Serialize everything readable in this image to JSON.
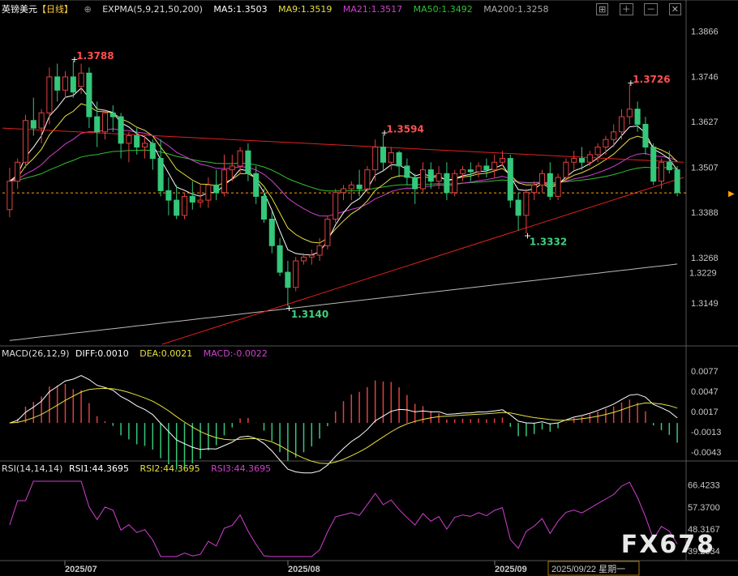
{
  "header": {
    "symbol": "英镑美元",
    "period": "【日线】",
    "expma": "EXPMA(5,9,21,50,200)",
    "ma5": "MA5:1.3503",
    "ma9": "MA9:1.3519",
    "ma21": "MA21:1.3517",
    "ma50": "MA50:1.3492",
    "ma200": "MA200:1.3258"
  },
  "macd_header": {
    "title": "MACD(26,12,9)",
    "diff": "DIFF:0.0010",
    "dea": "DEA:0.0021",
    "macd": "MACD:-0.0022"
  },
  "rsi_header": {
    "title": "RSI(14,14,14)",
    "rsi1": "RSI1:44.3695",
    "rsi2": "RSI2:44.3695",
    "rsi3": "RSI3:44.3695"
  },
  "x_labels": [
    "2025/07",
    "2025/08",
    "2025/09",
    "2025/09/22 星期一"
  ],
  "watermark": "FX678",
  "colors": {
    "up": "#e04040",
    "down": "#35c77a",
    "ma5": "#ffffff",
    "ma9": "#e8e040",
    "ma21": "#d040d0",
    "ma50": "#30c030",
    "ma200": "#bbbbbb",
    "trend": "#e02020",
    "current": "#ffa500"
  },
  "chart_data": [
    {
      "type": "candlestick",
      "title": "英镑美元【日线】",
      "y_ticks": [
        1.3866,
        1.3746,
        1.3627,
        1.3507,
        1.3388,
        1.3268,
        1.3149
      ],
      "current_price": 1.3439,
      "current_label": "1.3229",
      "ylim": [
        1.304,
        1.3905
      ],
      "annotations": [
        {
          "text": "1.3788",
          "type": "high"
        },
        {
          "text": "1.3594",
          "type": "high"
        },
        {
          "text": "1.3726",
          "type": "high"
        },
        {
          "text": "1.3140",
          "type": "low"
        },
        {
          "text": "1.3332",
          "type": "low"
        }
      ],
      "candles": [
        [
          1.3395,
          1.3505,
          1.347,
          1.3375
        ],
        [
          1.347,
          1.353,
          1.352,
          1.345
        ],
        [
          1.352,
          1.3645,
          1.363,
          1.3505
        ],
        [
          1.363,
          1.369,
          1.361,
          1.359
        ],
        [
          1.361,
          1.366,
          1.365,
          1.357
        ],
        [
          1.365,
          1.377,
          1.3745,
          1.362
        ],
        [
          1.3745,
          1.378,
          1.371,
          1.368
        ],
        [
          1.371,
          1.376,
          1.3745,
          1.369
        ],
        [
          1.3745,
          1.3788,
          1.3705,
          1.369
        ],
        [
          1.372,
          1.378,
          1.3755,
          1.37
        ],
        [
          1.3755,
          1.377,
          1.364,
          1.361
        ],
        [
          1.364,
          1.368,
          1.36,
          1.356
        ],
        [
          1.36,
          1.366,
          1.365,
          1.358
        ],
        [
          1.365,
          1.367,
          1.364,
          1.36
        ],
        [
          1.364,
          1.365,
          1.357,
          1.353
        ],
        [
          1.357,
          1.36,
          1.359,
          1.352
        ],
        [
          1.359,
          1.361,
          1.356,
          1.354
        ],
        [
          1.356,
          1.359,
          1.357,
          1.353
        ],
        [
          1.357,
          1.358,
          1.353,
          1.35
        ],
        [
          1.353,
          1.358,
          1.3445,
          1.343
        ],
        [
          1.3445,
          1.348,
          1.342,
          1.338
        ],
        [
          1.342,
          1.346,
          1.338,
          1.337
        ],
        [
          1.338,
          1.344,
          1.343,
          1.337
        ],
        [
          1.343,
          1.347,
          1.3415,
          1.3395
        ],
        [
          1.3415,
          1.346,
          1.342,
          1.34
        ],
        [
          1.342,
          1.348,
          1.346,
          1.34
        ],
        [
          1.346,
          1.35,
          1.344,
          1.342
        ],
        [
          1.344,
          1.354,
          1.35,
          1.343
        ],
        [
          1.35,
          1.354,
          1.351,
          1.347
        ],
        [
          1.351,
          1.356,
          1.355,
          1.349
        ],
        [
          1.355,
          1.357,
          1.349,
          1.347
        ],
        [
          1.349,
          1.351,
          1.343,
          1.341
        ],
        [
          1.343,
          1.345,
          1.337,
          1.336
        ],
        [
          1.337,
          1.339,
          1.33,
          1.328
        ],
        [
          1.33,
          1.332,
          1.323,
          1.322
        ],
        [
          1.323,
          1.326,
          1.319,
          1.314
        ],
        [
          1.319,
          1.327,
          1.326,
          1.318
        ],
        [
          1.326,
          1.328,
          1.327,
          1.325
        ],
        [
          1.327,
          1.329,
          1.3275,
          1.325
        ],
        [
          1.3275,
          1.332,
          1.33,
          1.326
        ],
        [
          1.33,
          1.338,
          1.337,
          1.329
        ],
        [
          1.337,
          1.345,
          1.344,
          1.336
        ],
        [
          1.344,
          1.346,
          1.345,
          1.342
        ],
        [
          1.345,
          1.347,
          1.346,
          1.342
        ],
        [
          1.346,
          1.35,
          1.345,
          1.343
        ],
        [
          1.345,
          1.351,
          1.35,
          1.344
        ],
        [
          1.35,
          1.358,
          1.356,
          1.347
        ],
        [
          1.356,
          1.3594,
          1.352,
          1.35
        ],
        [
          1.352,
          1.356,
          1.3545,
          1.35
        ],
        [
          1.3545,
          1.355,
          1.351,
          1.348
        ],
        [
          1.351,
          1.353,
          1.348,
          1.346
        ],
        [
          1.348,
          1.349,
          1.345,
          1.341
        ],
        [
          1.345,
          1.352,
          1.35,
          1.344
        ],
        [
          1.35,
          1.352,
          1.347,
          1.345
        ],
        [
          1.347,
          1.351,
          1.349,
          1.345
        ],
        [
          1.349,
          1.352,
          1.344,
          1.342
        ],
        [
          1.344,
          1.35,
          1.349,
          1.343
        ],
        [
          1.349,
          1.351,
          1.35,
          1.347
        ],
        [
          1.35,
          1.352,
          1.3495,
          1.347
        ],
        [
          1.3495,
          1.352,
          1.351,
          1.348
        ],
        [
          1.351,
          1.353,
          1.35,
          1.348
        ],
        [
          1.35,
          1.354,
          1.352,
          1.348
        ],
        [
          1.352,
          1.355,
          1.353,
          1.351
        ],
        [
          1.353,
          1.354,
          1.342,
          1.34
        ],
        [
          1.342,
          1.344,
          1.338,
          1.334
        ],
        [
          1.338,
          1.345,
          1.344,
          1.3332
        ],
        [
          1.344,
          1.347,
          1.346,
          1.342
        ],
        [
          1.346,
          1.35,
          1.349,
          1.344
        ],
        [
          1.349,
          1.352,
          1.343,
          1.342
        ],
        [
          1.343,
          1.349,
          1.348,
          1.342
        ],
        [
          1.348,
          1.353,
          1.352,
          1.347
        ],
        [
          1.352,
          1.355,
          1.353,
          1.35
        ],
        [
          1.353,
          1.356,
          1.352,
          1.35
        ],
        [
          1.352,
          1.355,
          1.354,
          1.351
        ],
        [
          1.354,
          1.357,
          1.356,
          1.352
        ],
        [
          1.356,
          1.359,
          1.358,
          1.354
        ],
        [
          1.358,
          1.362,
          1.36,
          1.356
        ],
        [
          1.36,
          1.366,
          1.364,
          1.358
        ],
        [
          1.364,
          1.3726,
          1.366,
          1.362
        ],
        [
          1.366,
          1.368,
          1.362,
          1.36
        ],
        [
          1.362,
          1.364,
          1.356,
          1.354
        ],
        [
          1.356,
          1.357,
          1.347,
          1.346
        ],
        [
          1.347,
          1.353,
          1.352,
          1.345
        ],
        [
          1.352,
          1.355,
          1.35,
          1.349
        ],
        [
          1.35,
          1.351,
          1.344,
          1.343
        ]
      ]
    },
    {
      "type": "bar",
      "title": "MACD(26,12,9)",
      "y_ticks": [
        0.0077,
        0.0047,
        0.0017,
        -0.0013,
        -0.0043
      ],
      "ylim": [
        -0.0055,
        0.009
      ]
    },
    {
      "type": "line",
      "title": "RSI(14,14,14)",
      "y_ticks": [
        66.4233,
        57.37,
        48.3167,
        39.2634
      ],
      "ylim": [
        36,
        70
      ]
    }
  ]
}
